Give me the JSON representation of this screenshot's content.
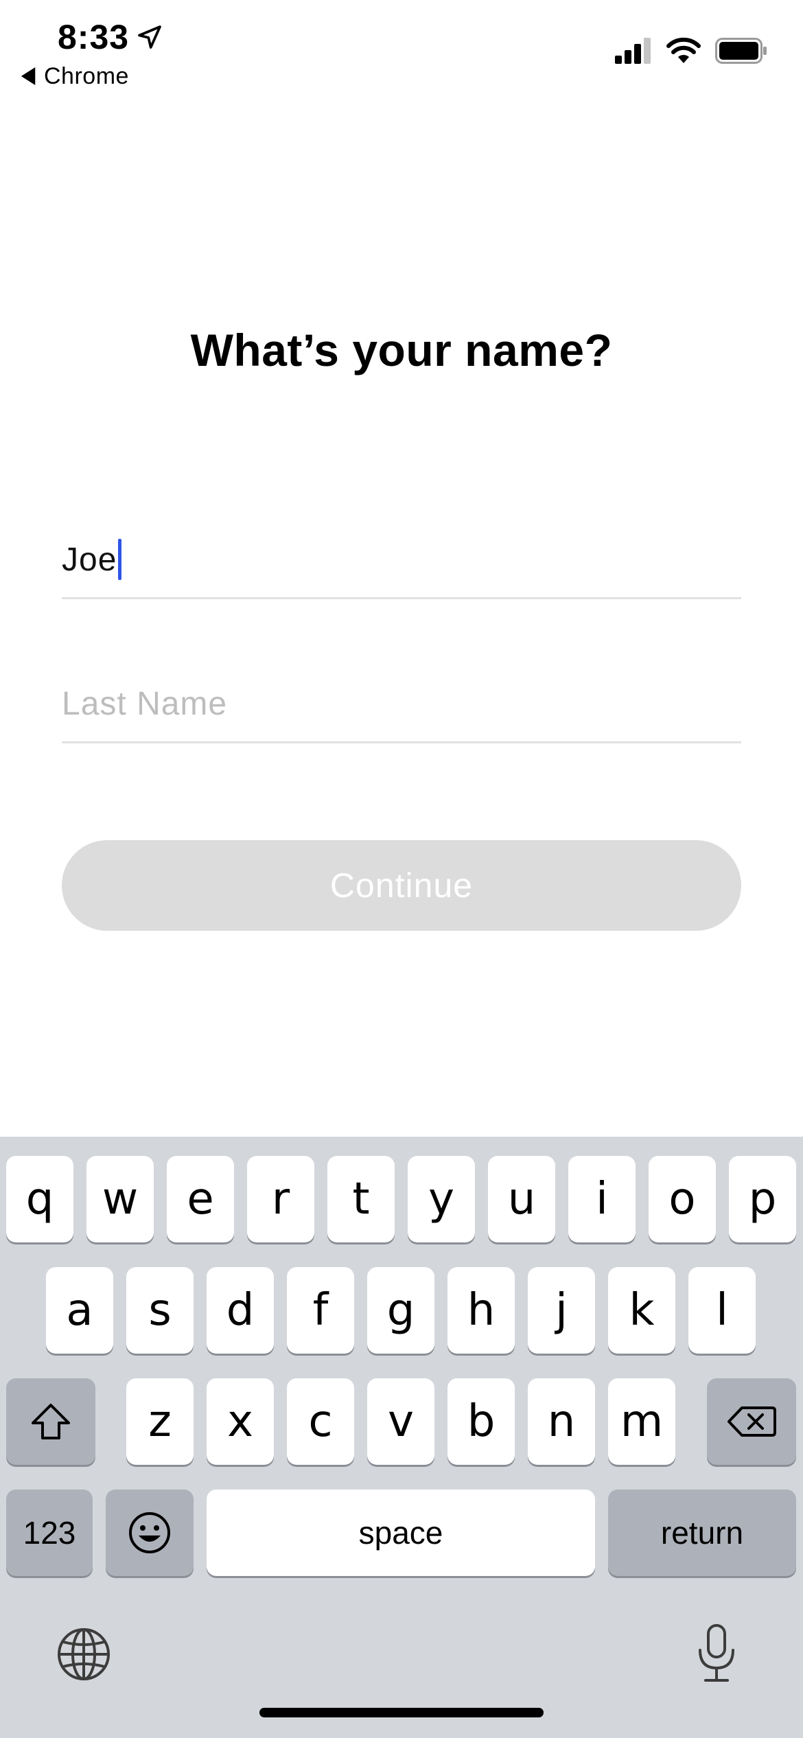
{
  "status_bar": {
    "time": "8:33",
    "back_app": "Chrome",
    "icons": [
      "location-arrow-icon",
      "cellular-signal-icon",
      "wifi-icon",
      "battery-icon"
    ]
  },
  "page": {
    "title": "What’s your name?",
    "first_name_value": "Joe",
    "last_name_placeholder": "Last Name",
    "continue_label": "Continue"
  },
  "colors": {
    "caret": "#2f55e6",
    "button_disabled": "#dcdcdc",
    "keyboard_bg": "#d3d6db",
    "key_dark": "#adb1b9"
  },
  "keyboard": {
    "row1": [
      "q",
      "w",
      "e",
      "r",
      "t",
      "y",
      "u",
      "i",
      "o",
      "p"
    ],
    "row2": [
      "a",
      "s",
      "d",
      "f",
      "g",
      "h",
      "j",
      "k",
      "l"
    ],
    "row3": [
      "z",
      "x",
      "c",
      "v",
      "b",
      "n",
      "m"
    ],
    "numbers_label": "123",
    "space_label": "space",
    "return_label": "return",
    "icons": [
      "shift-icon",
      "backspace-icon",
      "emoji-icon",
      "globe-icon",
      "microphone-icon"
    ]
  }
}
